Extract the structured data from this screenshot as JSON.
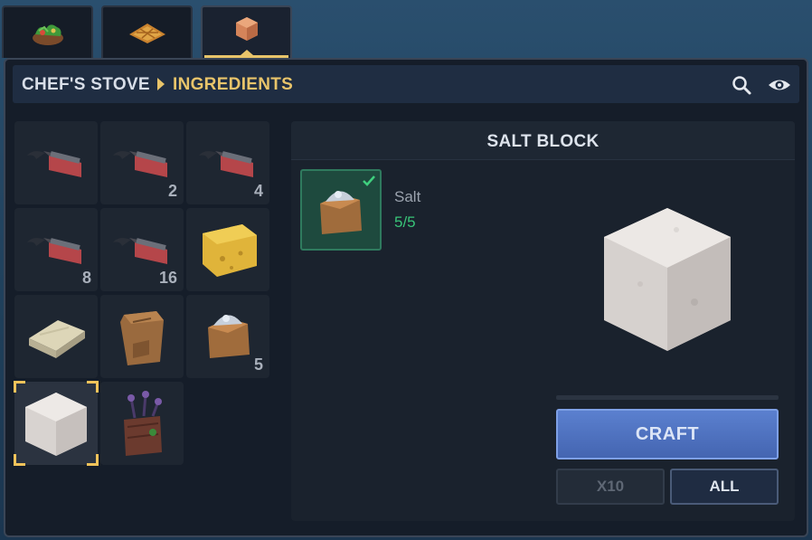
{
  "tabs": [
    {
      "name": "salad",
      "icon": "salad-icon",
      "active": false
    },
    {
      "name": "pie",
      "icon": "pie-icon",
      "active": false
    },
    {
      "name": "ingredients",
      "icon": "ingredient-icon",
      "active": true
    }
  ],
  "header": {
    "crumb_root": "CHEF'S STOVE",
    "crumb_current": "INGREDIENTS",
    "search_icon": "search-icon",
    "view_icon": "eye-icon"
  },
  "recipes": [
    {
      "item": "fish-fillet",
      "qty": ""
    },
    {
      "item": "fish-fillet",
      "qty": "2"
    },
    {
      "item": "fish-fillet",
      "qty": "4"
    },
    {
      "item": "fish-fillet",
      "qty": "8"
    },
    {
      "item": "fish-fillet",
      "qty": "16"
    },
    {
      "item": "cheese",
      "qty": ""
    },
    {
      "item": "butter",
      "qty": ""
    },
    {
      "item": "flour-sack",
      "qty": ""
    },
    {
      "item": "salt",
      "qty": "5"
    },
    {
      "item": "salt-block",
      "qty": "",
      "selected": true
    },
    {
      "item": "lavender-crate",
      "qty": ""
    }
  ],
  "detail": {
    "title": "SALT BLOCK",
    "ingredient": {
      "name": "Salt",
      "count": "5/5",
      "status": "check-icon"
    },
    "craft_label": "CRAFT",
    "x10_label": "X10",
    "all_label": "ALL"
  },
  "colors": {
    "accent": "#e8c46a",
    "craft": "#4f72c0",
    "ok": "#38c478"
  }
}
